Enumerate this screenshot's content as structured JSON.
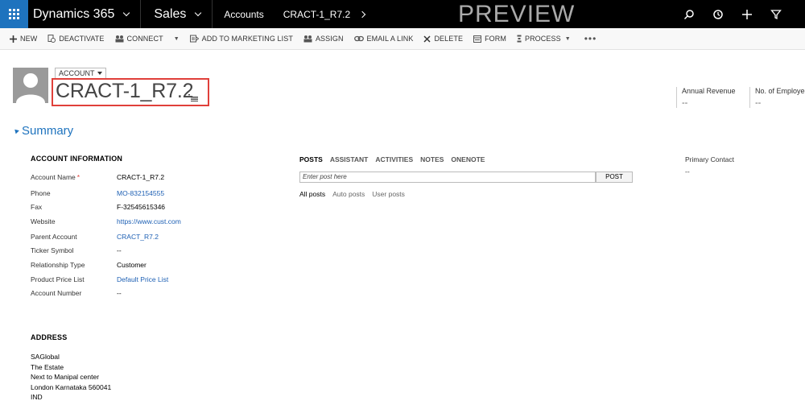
{
  "topnav": {
    "app_name": "Dynamics 365",
    "module": "Sales",
    "breadcrumb_entity": "Accounts",
    "breadcrumb_record": "CRACT-1_R7.2",
    "preview_label": "PREVIEW"
  },
  "commands": [
    {
      "label": "NEW",
      "icon": "plus-icon"
    },
    {
      "label": "DEACTIVATE",
      "icon": "deactivate-icon"
    },
    {
      "label": "CONNECT",
      "icon": "connect-icon"
    },
    {
      "label": "ADD TO MARKETING LIST",
      "icon": "marketing-list-icon"
    },
    {
      "label": "ASSIGN",
      "icon": "assign-icon"
    },
    {
      "label": "EMAIL A LINK",
      "icon": "link-icon"
    },
    {
      "label": "DELETE",
      "icon": "delete-icon"
    },
    {
      "label": "FORM",
      "icon": "form-icon"
    },
    {
      "label": "PROCESS",
      "icon": "process-icon"
    }
  ],
  "header": {
    "entity_type": "ACCOUNT",
    "record_name": "CRACT-1_R7.2",
    "kpis": [
      {
        "label": "Annual Revenue",
        "value": "--"
      },
      {
        "label": "No. of Employees",
        "value": "--"
      }
    ]
  },
  "summary": {
    "title": "Summary",
    "account_info": {
      "title": "ACCOUNT INFORMATION",
      "fields": [
        {
          "label": "Account Name",
          "value": "CRACT-1_R7.2",
          "required": "*"
        },
        {
          "label": "Phone",
          "value": "MO-832154555"
        },
        {
          "label": "Fax",
          "value": "F-32545615346"
        },
        {
          "label": "Website",
          "value": "https://www.cust.com"
        },
        {
          "label": "Parent Account",
          "value": "CRACT_R7.2"
        },
        {
          "label": "Ticker Symbol",
          "value": "--"
        },
        {
          "label": "Relationship Type",
          "value": "Customer"
        },
        {
          "label": "Product Price List",
          "value": "Default Price List"
        },
        {
          "label": "Account Number",
          "value": "--"
        }
      ]
    },
    "address": {
      "title": "ADDRESS",
      "lines": [
        "SAGlobal",
        "The Estate",
        "Next to Manipal center",
        "London Karnataka 560041",
        "IND"
      ]
    },
    "social": {
      "tabs": [
        "POSTS",
        "ASSISTANT",
        "ACTIVITIES",
        "NOTES",
        "ONENOTE"
      ],
      "post_placeholder": "Enter post here",
      "post_button": "POST",
      "filters": [
        "All posts",
        "Auto posts",
        "User posts"
      ]
    },
    "primary_contact": {
      "label": "Primary Contact",
      "value": "--"
    }
  },
  "colors": {
    "accent": "#1e73be",
    "highlight_border": "#e0403a",
    "link": "#1e60b4"
  }
}
